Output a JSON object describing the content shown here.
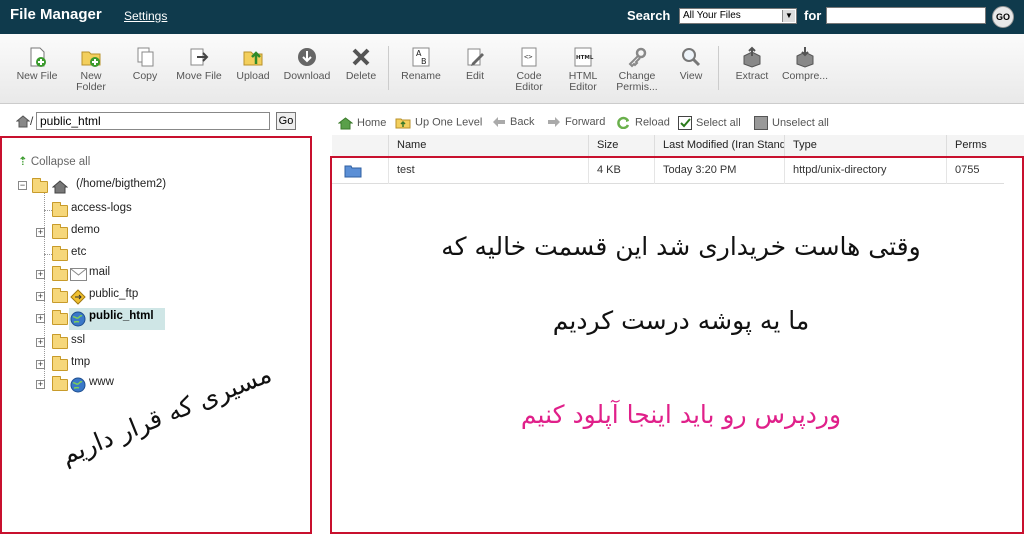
{
  "header": {
    "title": "File Manager",
    "settings": "Settings",
    "search_label": "Search",
    "search_scope": "All Your Files",
    "for_label": "for",
    "go": "GO"
  },
  "toolbar": {
    "new_file": "New File",
    "new_folder_1": "New",
    "new_folder_2": "Folder",
    "copy": "Copy",
    "move_file": "Move File",
    "upload": "Upload",
    "download": "Download",
    "delete": "Delete",
    "rename": "Rename",
    "edit": "Edit",
    "code_editor_1": "Code",
    "code_editor_2": "Editor",
    "html_editor_1": "HTML",
    "html_editor_2": "Editor",
    "change_perms_1": "Change",
    "change_perms_2": "Permis...",
    "view": "View",
    "extract": "Extract",
    "compress": "Compre..."
  },
  "path": {
    "value": "public_html",
    "go": "Go"
  },
  "nav": {
    "home": "Home",
    "up": "Up One Level",
    "back": "Back",
    "forward": "Forward",
    "reload": "Reload",
    "select_all": "Select all",
    "unselect_all": "Unselect all"
  },
  "tree": {
    "collapse": "Collapse all",
    "root": "(/home/bigthem2)",
    "items": [
      "access-logs",
      "demo",
      "etc",
      "mail",
      "public_ftp",
      "public_html",
      "ssl",
      "tmp",
      "www"
    ]
  },
  "table": {
    "columns": [
      "Name",
      "Size",
      "Last Modified (Iran Stand",
      "Type",
      "Perms"
    ],
    "rows": [
      {
        "name": "test",
        "size": "4 KB",
        "modified": "Today 3:20 PM",
        "type": "httpd/unix-directory",
        "perms": "0755"
      }
    ]
  },
  "annotations": {
    "left_note": "مسیری که قرار داریم",
    "main_line1": "وقتی هاست خریداری شد این قسمت خالیه که",
    "main_line2": "ما یه پوشه درست کردیم",
    "main_line3": "وردپرس رو باید اینجا آپلود کنیم",
    "pink_color": "#e0208a"
  }
}
